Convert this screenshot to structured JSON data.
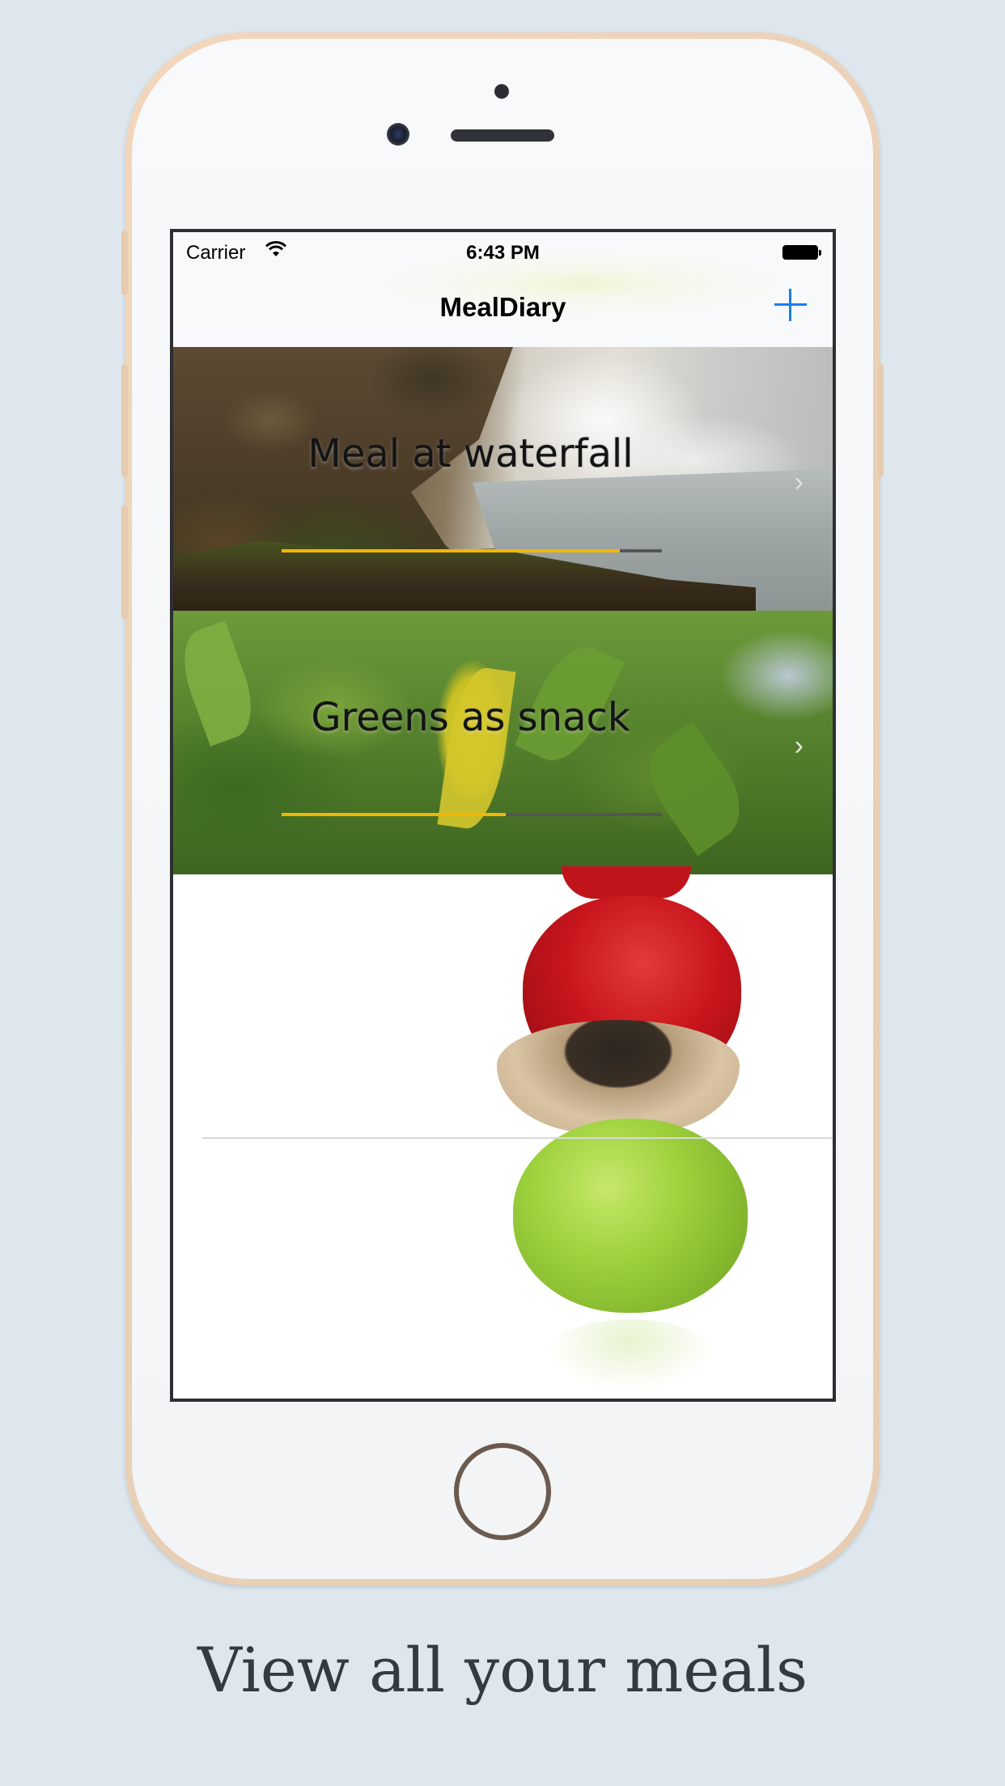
{
  "status_bar": {
    "carrier": "Carrier",
    "time": "6:43 PM"
  },
  "nav": {
    "title": "MealDiary",
    "add_icon": "plus-icon"
  },
  "meals": [
    {
      "name": "Meal at waterfall",
      "rating_fraction": 0.89,
      "image": "waterfall"
    },
    {
      "name": "Greens as snack",
      "rating_fraction": 0.59,
      "image": "plant-leaves"
    }
  ],
  "background_image": "apples-and-mushroom",
  "caption": "View all your meals",
  "colors": {
    "accent": "#1a7cf0",
    "rating_fill": "#f2b705",
    "rating_track": "#555555",
    "page_background": "#dde7ed"
  }
}
